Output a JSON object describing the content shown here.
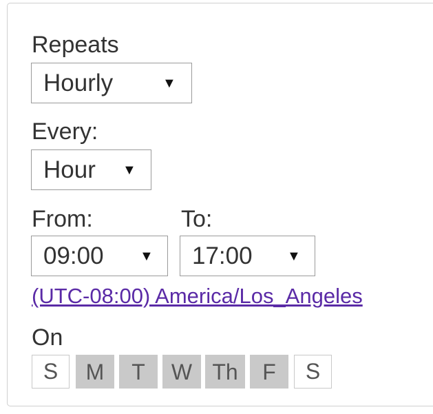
{
  "repeats": {
    "label": "Repeats",
    "value": "Hourly"
  },
  "every": {
    "label": "Every:",
    "value": "Hour"
  },
  "from": {
    "label": "From:",
    "value": "09:00"
  },
  "to": {
    "label": "To:",
    "value": "17:00"
  },
  "caret_glyph": "▼",
  "timezone_link": "(UTC-08:00) America/Los_Angeles",
  "on": {
    "label": "On",
    "days": [
      {
        "label": "S",
        "selected": false
      },
      {
        "label": "M",
        "selected": true
      },
      {
        "label": "T",
        "selected": true
      },
      {
        "label": "W",
        "selected": true
      },
      {
        "label": "Th",
        "selected": true
      },
      {
        "label": "F",
        "selected": true
      },
      {
        "label": "S",
        "selected": false
      }
    ]
  },
  "colors": {
    "link": "#5a2aa6",
    "day_selected": "#c9c9c9",
    "border": "#9a9a9a"
  }
}
